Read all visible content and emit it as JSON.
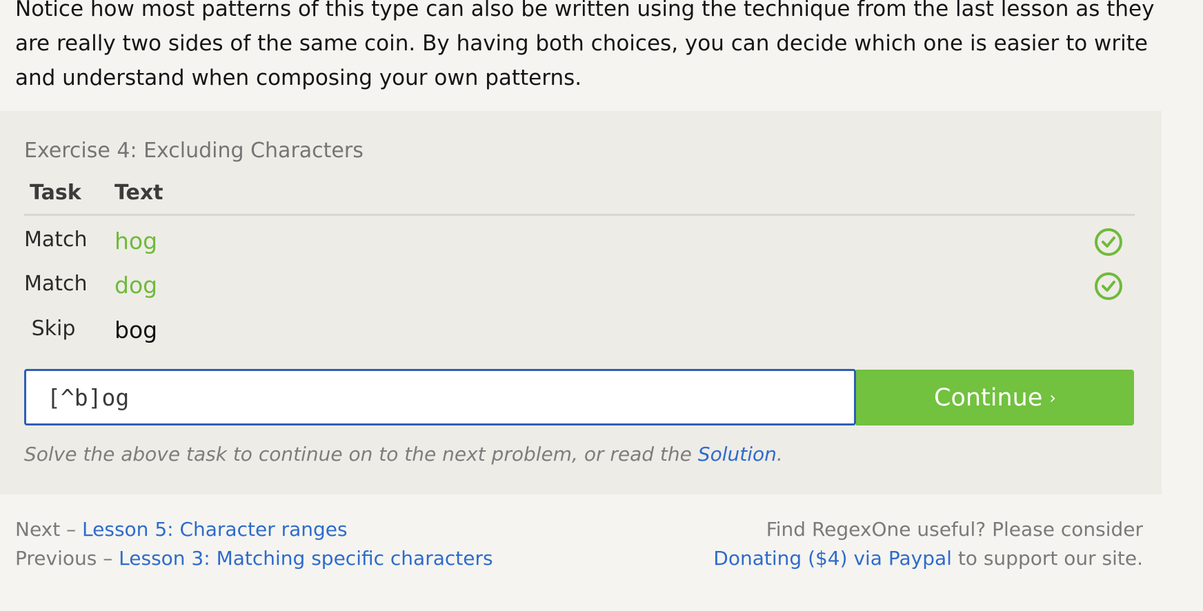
{
  "intro": {
    "text": "Notice how most patterns of this type can also be written using the technique from the last lesson as they are really two sides of the same coin. By having both choices, you can decide which one is easier to write and understand when composing your own patterns."
  },
  "exercise": {
    "title": "Exercise 4: Excluding Characters",
    "headers": {
      "task": "Task",
      "text": "Text"
    },
    "rows": [
      {
        "task": "Match",
        "text": "hog",
        "status": "matched"
      },
      {
        "task": "Match",
        "text": "dog",
        "status": "matched"
      },
      {
        "task": "Skip",
        "text": "bog",
        "status": "pending"
      }
    ],
    "input": {
      "value": "[^b]og"
    },
    "continue_label": "Continue",
    "continue_chevron": "›",
    "helper": {
      "prefix": "Solve the above task to continue on to the next problem, or read the ",
      "link": "Solution",
      "suffix": "."
    }
  },
  "footer": {
    "next_prefix": "Next – ",
    "next_link": "Lesson 5: Character ranges",
    "previous_prefix": "Previous – ",
    "previous_link": "Lesson 3: Matching specific characters",
    "donate_line1": "Find RegexOne useful? Please consider",
    "donate_link": "Donating ($4) via Paypal",
    "donate_suffix": " to support our site."
  },
  "colors": {
    "accent_green": "#72c13f",
    "match_green": "#6fba3c",
    "link_blue": "#2e6bcc",
    "input_border": "#2d5fb5"
  },
  "icons": {
    "check": "check-circle-icon"
  }
}
